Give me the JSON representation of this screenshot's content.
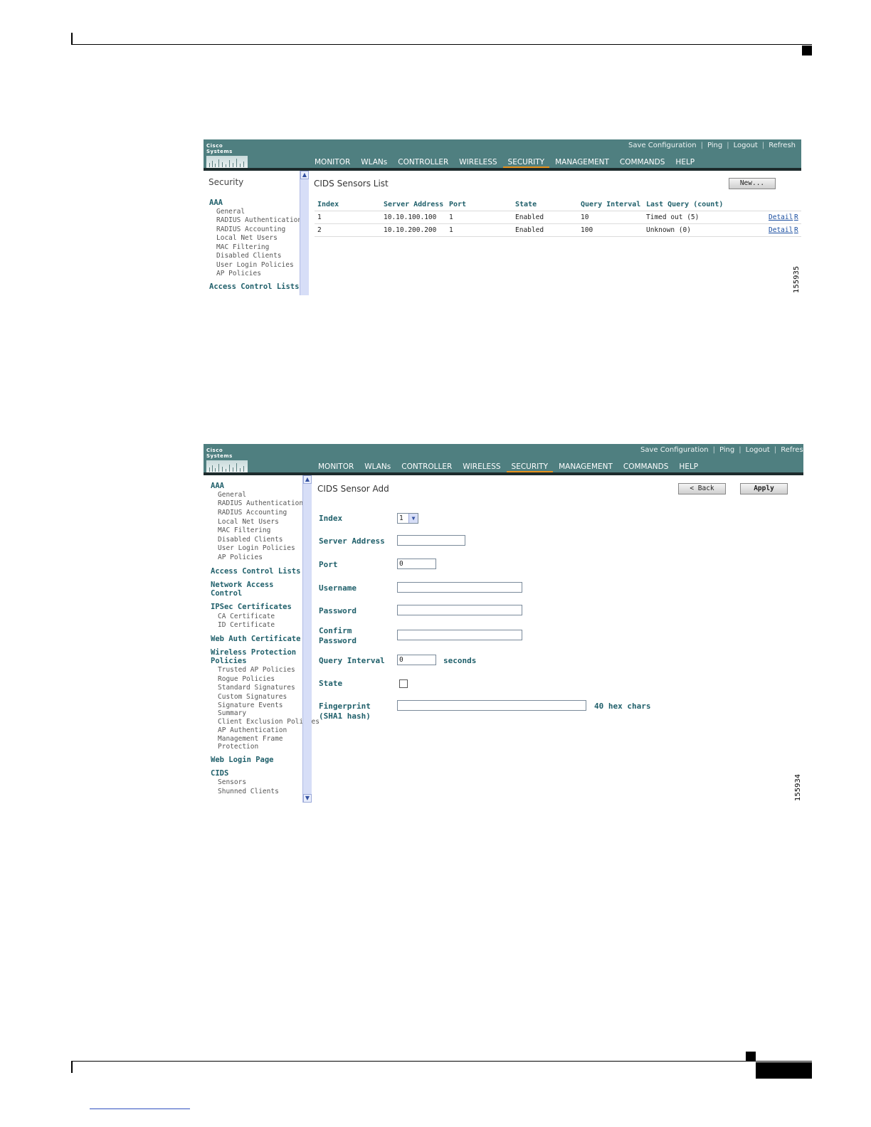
{
  "header": {
    "logo_text": "Cisco Systems",
    "util_links": [
      "Save Configuration",
      "Ping",
      "Logout",
      "Refresh"
    ],
    "nav_tabs": [
      "MONITOR",
      "WLANs",
      "CONTROLLER",
      "WIRELESS",
      "SECURITY",
      "MANAGEMENT",
      "COMMANDS",
      "HELP"
    ],
    "active_tab": "SECURITY"
  },
  "colors": {
    "header_bg": "#4f7f80",
    "accent": "#e8931e",
    "label_color": "#1f5f6a",
    "link_color": "#1a4ea0"
  },
  "shot1": {
    "sidebar": {
      "title": "Security",
      "aaa_title": "AAA",
      "aaa_items": [
        "General",
        "RADIUS Authentication",
        "RADIUS Accounting",
        "Local Net Users",
        "MAC Filtering",
        "Disabled Clients",
        "User Login Policies",
        "AP Policies"
      ],
      "acl_title": "Access Control Lists"
    },
    "page_title": "CIDS Sensors List",
    "new_button": "New...",
    "columns": [
      "Index",
      "Server Address",
      "Port",
      "State",
      "Query Interval",
      "Last Query (count)"
    ],
    "rows": [
      {
        "index": "1",
        "server": "10.10.100.100",
        "port": "1",
        "state": "Enabled",
        "interval": "10",
        "last": "Timed out (5)",
        "detail": "Detail",
        "more": "R"
      },
      {
        "index": "2",
        "server": "10.10.200.200",
        "port": "1",
        "state": "Enabled",
        "interval": "100",
        "last": "Unknown (0)",
        "detail": "Detail",
        "more": "R"
      }
    ],
    "figure_id": "155935"
  },
  "shot2": {
    "sidebar": {
      "aaa_title": "AAA",
      "aaa_items": [
        "General",
        "RADIUS Authentication",
        "RADIUS Accounting",
        "Local Net Users",
        "MAC Filtering",
        "Disabled Clients",
        "User Login Policies",
        "AP Policies"
      ],
      "acl_title": "Access Control Lists",
      "nac_title_1": "Network Access",
      "nac_title_2": "Control",
      "ipsec_title": "IPSec Certificates",
      "ipsec_items": [
        "CA Certificate",
        "ID Certificate"
      ],
      "webauth_title": "Web Auth Certificate",
      "wpp_title_1": "Wireless Protection",
      "wpp_title_2": "Policies",
      "wpp_items": [
        "Trusted AP Policies",
        "Rogue Policies",
        "Standard Signatures",
        "Custom Signatures",
        "Signature Events",
        "Summary",
        "Client Exclusion Policies",
        "AP Authentication",
        "Management Frame",
        "Protection"
      ],
      "weblogin_title": "Web Login Page",
      "cids_title": "CIDS",
      "cids_items": [
        "Sensors",
        "Shunned Clients"
      ]
    },
    "page_title": "CIDS Sensor Add",
    "back_button": "< Back",
    "apply_button": "Apply",
    "form": {
      "index_label": "Index",
      "index_value": "1",
      "server_label": "Server Address",
      "server_value": "",
      "port_label": "Port",
      "port_value": "0",
      "username_label": "Username",
      "username_value": "",
      "password_label": "Password",
      "password_value": "",
      "confirm_label_1": "Confirm",
      "confirm_label_2": "Password",
      "confirm_value": "",
      "interval_label": "Query Interval",
      "interval_value": "0",
      "interval_unit": "seconds",
      "state_label": "State",
      "state_checked": false,
      "fingerprint_label_1": "Fingerprint",
      "fingerprint_label_2": "(SHA1 hash)",
      "fingerprint_value": "",
      "fingerprint_note": "40 hex chars"
    },
    "figure_id": "155934"
  }
}
